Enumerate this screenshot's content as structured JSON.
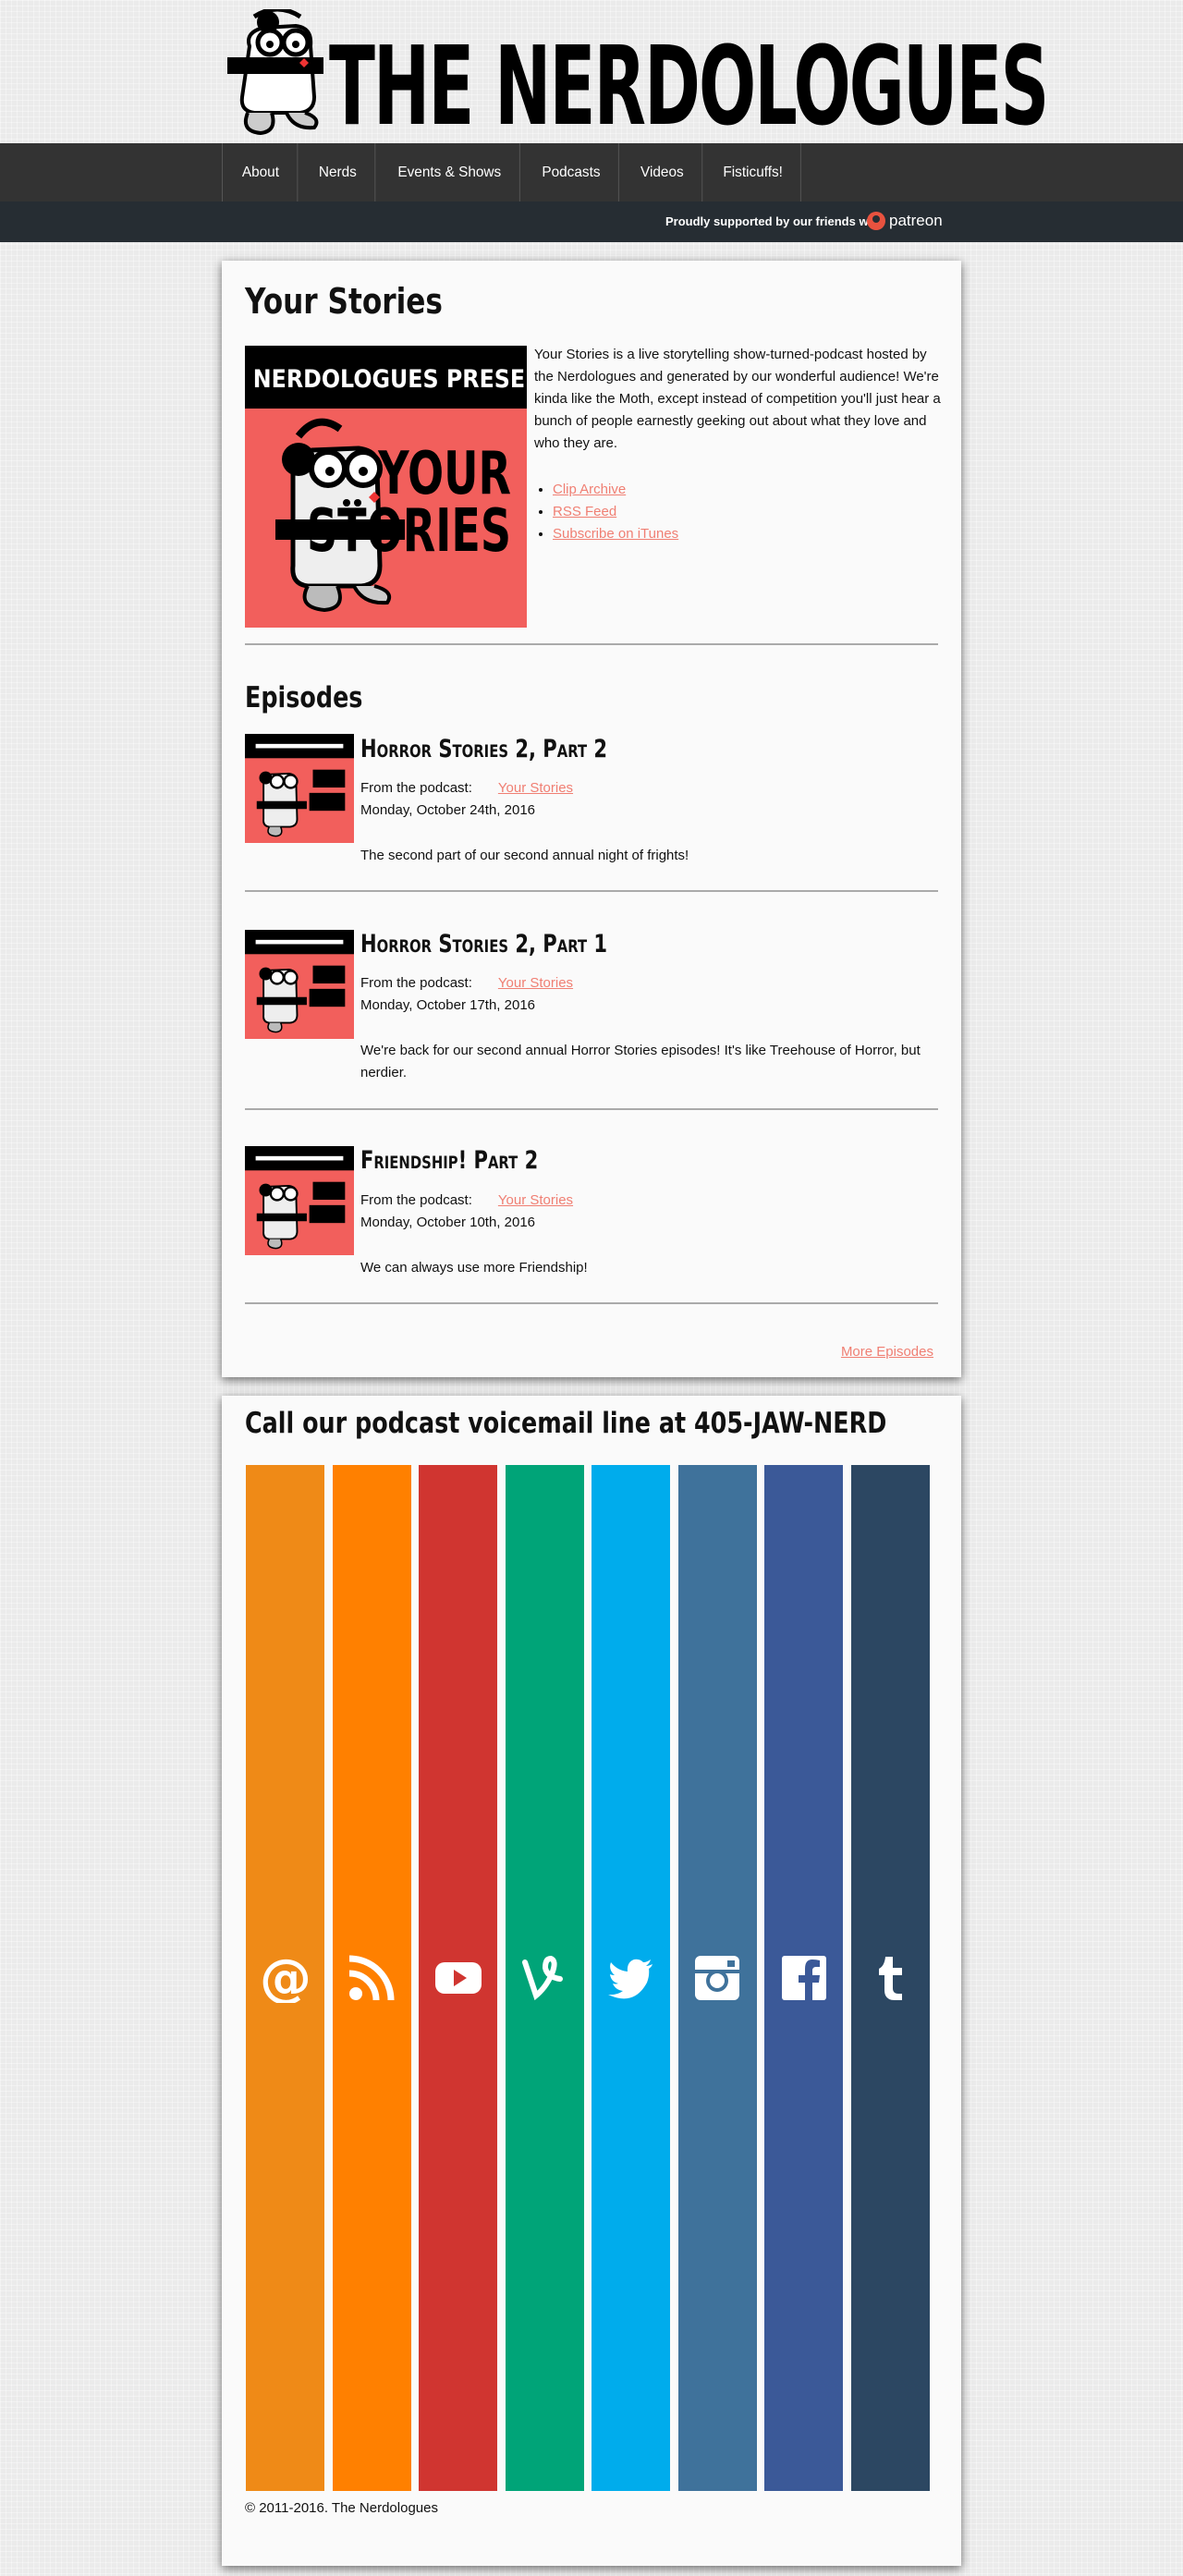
{
  "site": {
    "title": "THE NERDOLOGUES"
  },
  "nav": {
    "items": [
      "About",
      "Nerds",
      "Events & Shows",
      "Podcasts",
      "Videos",
      "Fisticuffs!"
    ]
  },
  "support": {
    "text": "Proudly supported by our friends with",
    "brand": "patreon"
  },
  "podcast": {
    "title": "Your Stories",
    "art": {
      "top_text": "THE NERDOLOGUES PRESENTS",
      "title_line1": "YOUR",
      "title_line2": "STORIES",
      "bg": "#f25f5c"
    },
    "description": "Your Stories is a live storytelling show-turned-podcast hosted by the Nerdologues and generated by our wonderful audience! We're kinda like the Moth, except instead of competition you'll just hear a bunch of people earnestly geeking out about what they love and who they are.",
    "links": [
      "Clip Archive",
      "RSS Feed",
      "Subscribe on iTunes"
    ]
  },
  "episodes": {
    "heading": "Episodes",
    "from_label": "From the podcast:",
    "items": [
      {
        "title": "Horror Stories 2, Part 2",
        "podcast": "Your Stories",
        "date": "Monday, October 24th, 2016",
        "desc": "The second part of our second annual night of frights!"
      },
      {
        "title": "Horror Stories 2, Part 1",
        "podcast": "Your Stories",
        "date": "Monday, October 17th, 2016",
        "desc": "We're back for our second annual Horror Stories episodes! It's like Treehouse of Horror, but nerdier."
      },
      {
        "title": "Friendship! Part 2",
        "podcast": "Your Stories",
        "date": "Monday, October 10th, 2016",
        "desc": "We can always use more Friendship!"
      }
    ],
    "more": "More Episodes"
  },
  "voicemail": {
    "heading": "Call our podcast voicemail line at 405-JAW-NERD"
  },
  "socials": [
    {
      "icon": "email-icon",
      "color": "#ef8a17"
    },
    {
      "icon": "rss-icon",
      "color": "#ff8000"
    },
    {
      "icon": "youtube-icon",
      "color": "#d03530"
    },
    {
      "icon": "vine-icon",
      "color": "#00a478"
    },
    {
      "icon": "twitter-icon",
      "color": "#00acec"
    },
    {
      "icon": "instagram-icon",
      "color": "#3f729b"
    },
    {
      "icon": "facebook-icon",
      "color": "#3b5998"
    },
    {
      "icon": "tumblr-icon",
      "color": "#2c4762"
    }
  ],
  "footer": {
    "copyright": "© 2011-2016. The Nerdologues"
  }
}
